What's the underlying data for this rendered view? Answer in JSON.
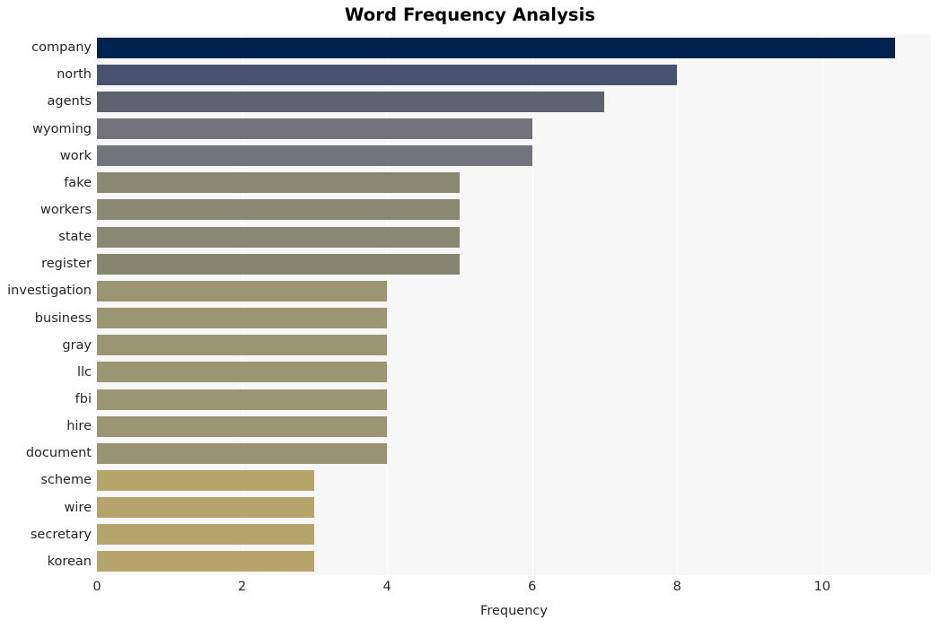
{
  "chart_data": {
    "type": "bar",
    "orientation": "horizontal",
    "title": "Word Frequency Analysis",
    "xlabel": "Frequency",
    "ylabel": "",
    "categories": [
      "company",
      "north",
      "agents",
      "wyoming",
      "work",
      "fake",
      "workers",
      "state",
      "register",
      "investigation",
      "business",
      "gray",
      "llc",
      "fbi",
      "hire",
      "document",
      "scheme",
      "wire",
      "secretary",
      "korean"
    ],
    "values": [
      11,
      8,
      7,
      6,
      6,
      5,
      5,
      5,
      5,
      4,
      4,
      4,
      4,
      4,
      4,
      4,
      3,
      3,
      3,
      3
    ],
    "bar_colors": [
      "#00224e",
      "#47526e",
      "#5e616e",
      "#71727a",
      "#74757c",
      "#888873",
      "#888873",
      "#888873",
      "#86856f",
      "#9c9572",
      "#9c9572",
      "#9c9572",
      "#9c9572",
      "#9c9572",
      "#9c9572",
      "#9a9372",
      "#b5a56c",
      "#b5a56c",
      "#b5a56c",
      "#b5a56c"
    ],
    "xticks": [
      0,
      2,
      4,
      6,
      8,
      10
    ],
    "xtick_labels": [
      "0",
      "2",
      "4",
      "6",
      "8",
      "10"
    ],
    "xlim": [
      0,
      11.5
    ],
    "grid": true,
    "grid_axis": "x",
    "legend": "none",
    "colormap": "cividis",
    "plot_background": "#f7f7f7",
    "figure_background": "#ffffff",
    "text_color": "#262626",
    "gridline_color": "#ffffff"
  }
}
